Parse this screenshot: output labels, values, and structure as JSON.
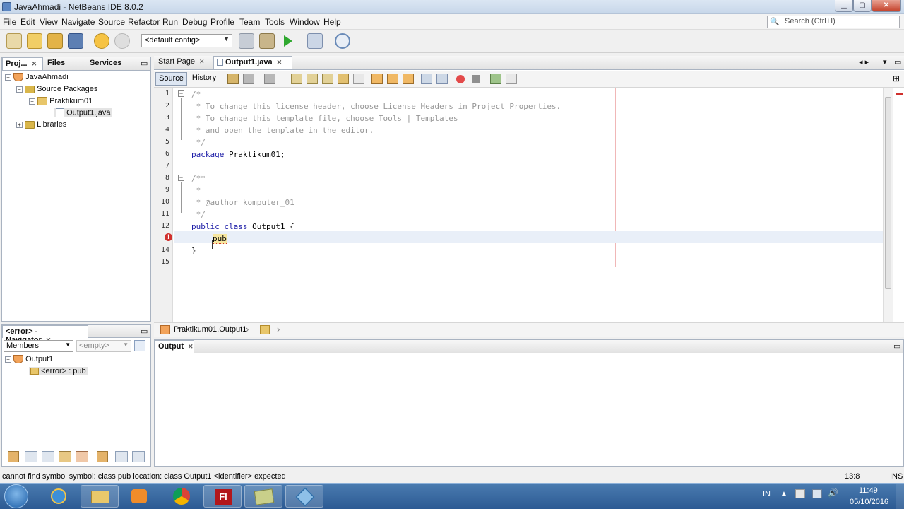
{
  "window": {
    "title": "JavaAhmadi - NetBeans IDE 8.0.2",
    "min": "▁",
    "max": "▢",
    "close": "✕"
  },
  "menu": [
    "File",
    "Edit",
    "View",
    "Navigate",
    "Source",
    "Refactor",
    "Run",
    "Debug",
    "Profile",
    "Team",
    "Tools",
    "Window",
    "Help"
  ],
  "search": {
    "placeholder": "Search (Ctrl+I)"
  },
  "toolbar": {
    "config": "<default config>"
  },
  "projects": {
    "tabs": [
      "Proj...",
      "Files",
      "Services"
    ],
    "tree": [
      "JavaAhmadi",
      "Source Packages",
      "Praktikum01",
      "Output1.java",
      "Libraries"
    ]
  },
  "navigator": {
    "title": "<error> - Navigator",
    "filter": "Members",
    "empty": "<empty>",
    "tree": [
      "Output1",
      "<error> : pub"
    ]
  },
  "editor": {
    "tabs": [
      "Start Page",
      "Output1.java"
    ],
    "source_tab": "Source",
    "history_tab": "History",
    "line_numbers": [
      "1",
      "2",
      "3",
      "4",
      "5",
      "6",
      "7",
      "8",
      "9",
      "10",
      "11",
      "12",
      "14",
      "15"
    ],
    "lines": {
      "l1": "/*",
      "l2": " * To change this license header, choose License Headers in Project Properties.",
      "l3": " * To change this template file, choose Tools | Templates",
      "l4": " * and open the template in the editor.",
      "l5": " */",
      "l6_kw": "package",
      "l6_rest": " Praktikum01;",
      "l8": "/**",
      "l9": " *",
      "l10": " * @author komputer_01",
      "l11": " */",
      "l12_kw": "public class",
      "l12_rest": " Output1 {",
      "l13": "pub",
      "l14": "}"
    },
    "breadcrumb": "Praktikum01.Output1"
  },
  "output": {
    "title": "Output"
  },
  "status": {
    "message": "cannot find symbol   symbol:   class pub   location: class Output1  <identifier> expected",
    "position": "13:8",
    "mode": "INS"
  },
  "taskbar": {
    "lang": "IN",
    "time": "11:49",
    "date": "05/10/2016"
  },
  "colors": {
    "keyword": "#1a1aa6",
    "comment": "#969696",
    "error": "#d0302d"
  }
}
